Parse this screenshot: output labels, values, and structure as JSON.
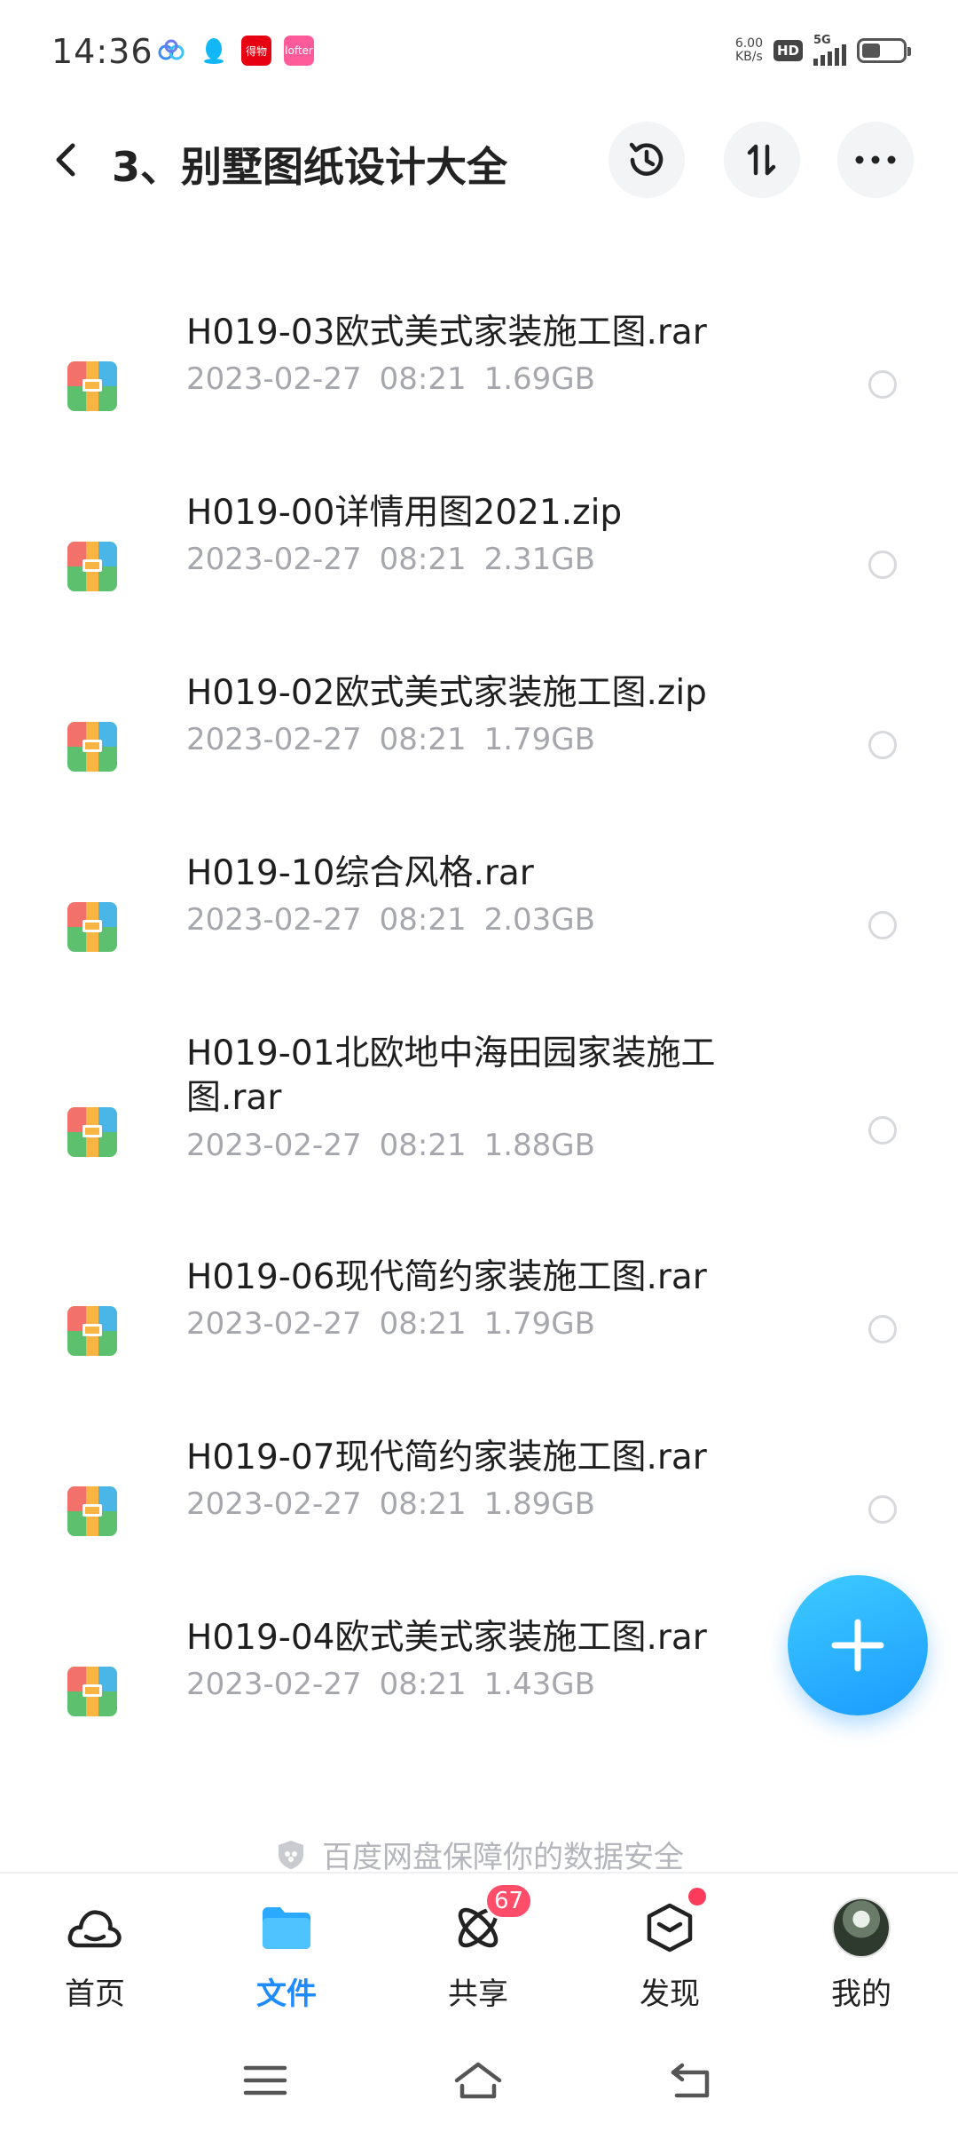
{
  "status_bar": {
    "time": "14:36",
    "speed_value": "6.00",
    "speed_unit": "KB/s",
    "hd": "HD",
    "network": "5G",
    "notif_red": "得物",
    "notif_pink": "lofter"
  },
  "header": {
    "title": "3、别墅图纸设计大全"
  },
  "files": [
    {
      "name": "H019-03欧式美式家装施工图.rar",
      "date": "2023-02-27",
      "time": "08:21",
      "size": "1.69GB"
    },
    {
      "name": "H019-00详情用图2021.zip",
      "date": "2023-02-27",
      "time": "08:21",
      "size": "2.31GB"
    },
    {
      "name": "H019-02欧式美式家装施工图.zip",
      "date": "2023-02-27",
      "time": "08:21",
      "size": "1.79GB"
    },
    {
      "name": "H019-10综合风格.rar",
      "date": "2023-02-27",
      "time": "08:21",
      "size": "2.03GB"
    },
    {
      "name": "H019-01北欧地中海田园家装施工图.rar",
      "date": "2023-02-27",
      "time": "08:21",
      "size": "1.88GB"
    },
    {
      "name": "H019-06现代简约家装施工图.rar",
      "date": "2023-02-27",
      "time": "08:21",
      "size": "1.79GB"
    },
    {
      "name": "H019-07现代简约家装施工图.rar",
      "date": "2023-02-27",
      "time": "08:21",
      "size": "1.89GB"
    },
    {
      "name": "H019-04欧式美式家装施工图.rar",
      "date": "2023-02-27",
      "time": "08:21",
      "size": "1.43GB"
    }
  ],
  "security_note": "百度网盘保障你的数据安全",
  "bottom_nav": {
    "home": "首页",
    "files": "文件",
    "share": "共享",
    "share_badge": "67",
    "discover": "发现",
    "mine": "我的"
  },
  "colors": {
    "accent": "#1e8cff",
    "badge": "#ff4d6a",
    "meta_text": "#a5a7ad"
  },
  "icons": {
    "back": "chevron-left-icon",
    "history": "history-icon",
    "sort": "sort-icon",
    "more": "more-horizontal-icon",
    "file": "archive-file-icon",
    "fab": "plus-icon",
    "shield": "shield-icon",
    "home": "cloud-home-icon",
    "files": "folder-icon",
    "share": "atom-share-icon",
    "discover": "cube-discover-icon",
    "mine": "avatar"
  }
}
